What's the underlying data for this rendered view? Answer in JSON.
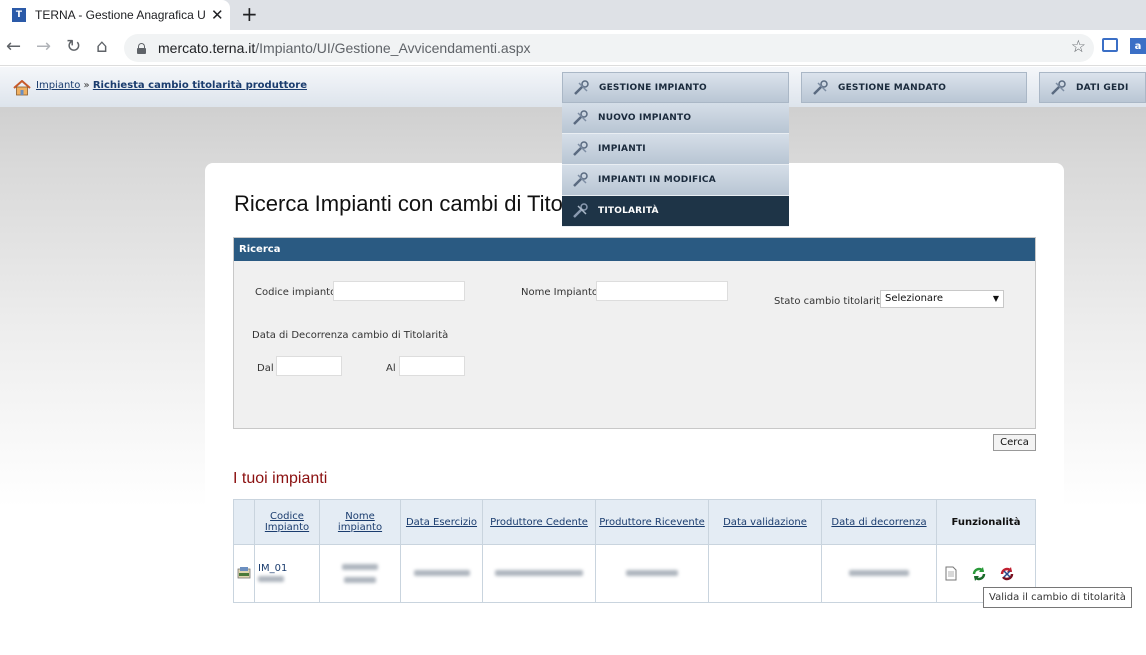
{
  "browser": {
    "tab_title": "TERNA - Gestione Anagrafica Uni",
    "tab_close": "✕",
    "new_tab": "+",
    "url_host": "mercato.terna.it",
    "url_path": "/Impianto/UI/Gestione_Avvicendamenti.aspx",
    "nav": {
      "back": "←",
      "forward": "→",
      "reload": "↻",
      "home": "⌂",
      "star": "☆"
    }
  },
  "breadcrumb": {
    "root": "Impianto",
    "separator": " » ",
    "current": "Richiesta cambio titolarità produttore"
  },
  "top_menu": {
    "gestione_impianto": "GESTIONE IMPIANTO",
    "gestione_mandato": "GESTIONE MANDATO",
    "dati_gedi": "DATI GEDI"
  },
  "dropdown_items": [
    "NUOVO IMPIANTO",
    "IMPIANTI",
    "IMPIANTI IN MODIFICA",
    "TITOLARITÀ"
  ],
  "page_title": "Ricerca Impianti con cambi di Titolarità",
  "search": {
    "header": "Ricerca",
    "codice_label": "Codice impianto",
    "nome_label": "Nome Impianto",
    "stato_label": "Stato cambio titolarità",
    "stato_value": "Selezionare",
    "stato_arrow": "▼",
    "decorrenza_label": "Data di Decorrenza cambio di Titolarità",
    "dal_label": "Dal",
    "al_label": "Al",
    "cerca_button": "Cerca"
  },
  "section_title": "I tuoi impianti",
  "table": {
    "headers": {
      "codice_line1": "Codice",
      "codice_line2": "Impianto",
      "nome": "Nome impianto",
      "data_esercizio": "Data Esercizio",
      "cedente": "Produttore Cedente",
      "ricevente": "Produttore Ricevente",
      "validazione": "Data validazione",
      "decorrenza": "Data di decorrenza",
      "funzionalita": "Funzionalità"
    },
    "row": {
      "codice": "IM_01"
    }
  },
  "tooltip": "Valida il cambio di titolarità"
}
